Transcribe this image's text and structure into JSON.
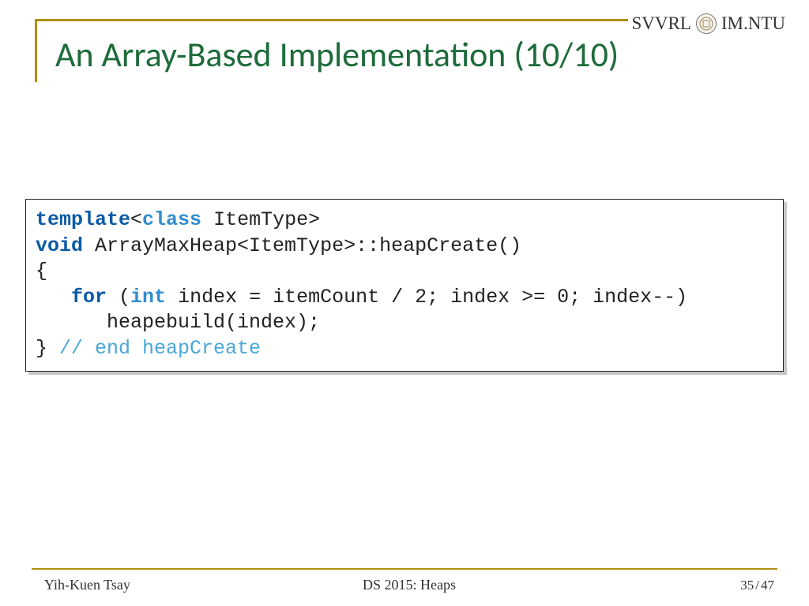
{
  "header": {
    "left_org": "SVVRL",
    "right_org": "IM.NTU",
    "logo_label": "ntu-seal-icon"
  },
  "title": "An Array-Based Implementation (10/10)",
  "code": {
    "l1a": "template",
    "l1b": "<",
    "l1c": "class",
    "l1d": " ItemType>",
    "l2a": "void",
    "l2b": " ArrayMaxHeap<ItemType>::heapCreate()",
    "l3": "{",
    "l4a": "   ",
    "l4b": "for",
    "l4c": " (",
    "l4d": "int",
    "l4e": " index = itemCount / 2; index >= 0; index--)",
    "l5": "      heapebuild(index);",
    "l6a": "} ",
    "l6b": "// end heapCreate"
  },
  "footer": {
    "author": "Yih-Kuen Tsay",
    "course": "DS 2015: Heaps",
    "page_current": "35",
    "page_sep": "/",
    "page_total": "47"
  }
}
